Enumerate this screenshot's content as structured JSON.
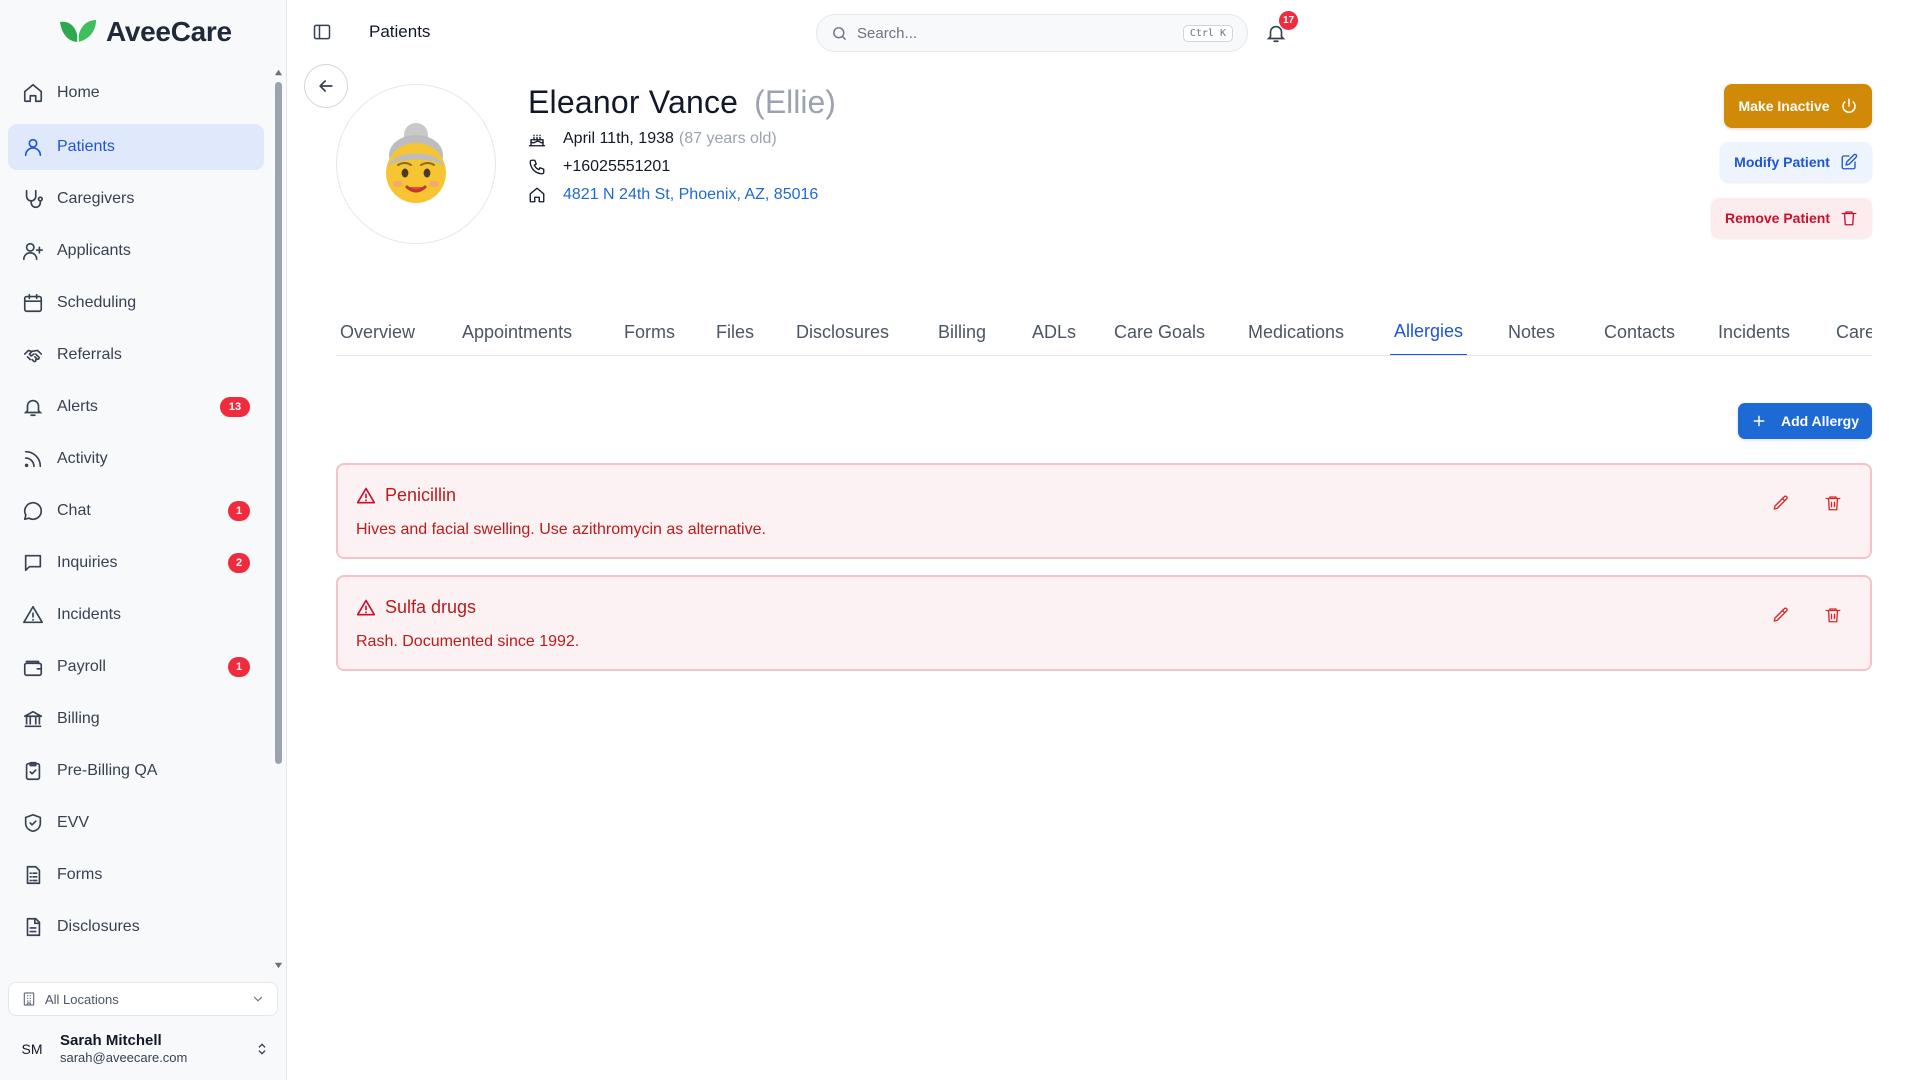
{
  "app": {
    "logo_text": "AveeCare",
    "page_title": "Patients"
  },
  "sidebar": {
    "items": [
      {
        "label": "Home",
        "icon": "home-icon",
        "active": false,
        "badge": ""
      },
      {
        "label": "Patients",
        "icon": "user-icon",
        "active": true,
        "badge": ""
      },
      {
        "label": "Caregivers",
        "icon": "stethoscope-icon",
        "active": false,
        "badge": ""
      },
      {
        "label": "Applicants",
        "icon": "user-plus-icon",
        "active": false,
        "badge": ""
      },
      {
        "label": "Scheduling",
        "icon": "calendar-icon",
        "active": false,
        "badge": ""
      },
      {
        "label": "Referrals",
        "icon": "handshake-icon",
        "active": false,
        "badge": ""
      },
      {
        "label": "Alerts",
        "icon": "bell-icon",
        "active": false,
        "badge": "13"
      },
      {
        "label": "Activity",
        "icon": "rss-icon",
        "active": false,
        "badge": ""
      },
      {
        "label": "Chat",
        "icon": "chat-icon",
        "active": false,
        "badge": "1"
      },
      {
        "label": "Inquiries",
        "icon": "message-square-icon",
        "active": false,
        "badge": "2"
      },
      {
        "label": "Incidents",
        "icon": "warning-icon",
        "active": false,
        "badge": ""
      },
      {
        "label": "Payroll",
        "icon": "wallet-icon",
        "active": false,
        "badge": "1"
      },
      {
        "label": "Billing",
        "icon": "bank-icon",
        "active": false,
        "badge": ""
      },
      {
        "label": "Pre-Billing QA",
        "icon": "clipboard-check-icon",
        "active": false,
        "badge": ""
      },
      {
        "label": "EVV",
        "icon": "shield-check-icon",
        "active": false,
        "badge": ""
      },
      {
        "label": "Forms",
        "icon": "form-icon",
        "active": false,
        "badge": ""
      },
      {
        "label": "Disclosures",
        "icon": "document-icon",
        "active": false,
        "badge": ""
      }
    ],
    "location_select": "All Locations",
    "user": {
      "initials": "SM",
      "name": "Sarah Mitchell",
      "email": "sarah@aveecare.com"
    }
  },
  "topbar": {
    "search_placeholder": "Search...",
    "search_shortcut": "Ctrl K",
    "notification_count": "17"
  },
  "patient": {
    "name": "Eleanor Vance",
    "nickname": "(Ellie)",
    "birthdate": "April 11th, 1938",
    "age": "(87 years old)",
    "phone": "+16025551201",
    "address": "4821 N 24th St, Phoenix, AZ, 85016"
  },
  "actions": {
    "make_inactive": "Make Inactive",
    "modify": "Modify Patient",
    "remove": "Remove Patient"
  },
  "tabs": [
    {
      "label": "Overview",
      "active": false
    },
    {
      "label": "Appointments",
      "active": false
    },
    {
      "label": "Forms",
      "active": false
    },
    {
      "label": "Files",
      "active": false
    },
    {
      "label": "Disclosures",
      "active": false
    },
    {
      "label": "Billing",
      "active": false
    },
    {
      "label": "ADLs",
      "active": false
    },
    {
      "label": "Care Goals",
      "active": false
    },
    {
      "label": "Medications",
      "active": false
    },
    {
      "label": "Allergies",
      "active": true
    },
    {
      "label": "Notes",
      "active": false
    },
    {
      "label": "Contacts",
      "active": false
    },
    {
      "label": "Incidents",
      "active": false
    },
    {
      "label": "Care Plans",
      "active": false
    }
  ],
  "allergies": {
    "add_label": "Add Allergy",
    "items": [
      {
        "name": "Penicillin",
        "description": "Hives and facial swelling. Use azithromycin as alternative."
      },
      {
        "name": "Sulfa drugs",
        "description": "Rash. Documented since 1992."
      }
    ]
  },
  "colors": {
    "brand_green": "#2fa84f",
    "accent_blue": "#1e55d4",
    "warning_orange": "#d18a08",
    "danger_red": "#c8102e",
    "badge_red": "#ef2b3d"
  }
}
